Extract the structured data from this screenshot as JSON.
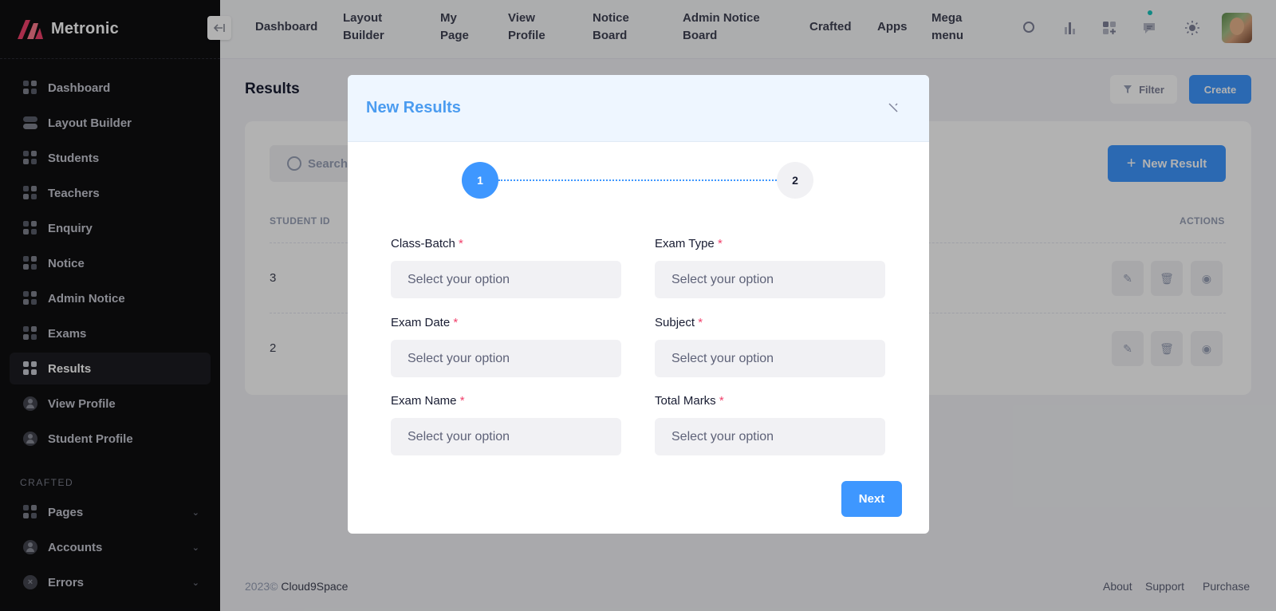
{
  "app": {
    "name": "Metronic"
  },
  "sidebar": {
    "items": [
      {
        "label": "Dashboard",
        "icon": "grid-icon"
      },
      {
        "label": "Layout Builder",
        "icon": "toggle-icon"
      },
      {
        "label": "Students",
        "icon": "grid-icon"
      },
      {
        "label": "Teachers",
        "icon": "grid-icon"
      },
      {
        "label": "Enquiry",
        "icon": "grid-icon"
      },
      {
        "label": "Notice",
        "icon": "grid-icon"
      },
      {
        "label": "Admin Notice",
        "icon": "grid-icon"
      },
      {
        "label": "Exams",
        "icon": "grid-icon"
      },
      {
        "label": "Results",
        "icon": "grid-icon",
        "active": true
      },
      {
        "label": "View Profile",
        "icon": "user-icon"
      },
      {
        "label": "Student Profile",
        "icon": "user-icon"
      }
    ],
    "section_title": "CRAFTED",
    "crafted_items": [
      {
        "label": "Pages",
        "icon": "grid-plus-icon"
      },
      {
        "label": "Accounts",
        "icon": "user-icon"
      },
      {
        "label": "Errors",
        "icon": "error-icon"
      }
    ]
  },
  "header": {
    "nav": [
      {
        "line1": "Dashboard",
        "line2": ""
      },
      {
        "line1": "Layout",
        "line2": "Builder"
      },
      {
        "line1": "My",
        "line2": "Page"
      },
      {
        "line1": "View",
        "line2": "Profile"
      },
      {
        "line1": "Notice",
        "line2": "Board"
      },
      {
        "line1": "Admin Notice",
        "line2": "Board"
      },
      {
        "line1": "Crafted",
        "line2": ""
      },
      {
        "line1": "Apps",
        "line2": ""
      },
      {
        "line1": "Mega",
        "line2": "menu"
      }
    ],
    "icons": [
      "search-icon",
      "chart-icon",
      "apps-icon",
      "chat-icon",
      "sun-icon"
    ]
  },
  "page": {
    "title": "Results",
    "filter_label": "Filter",
    "create_label": "Create",
    "search_placeholder": "Search",
    "new_result_label": "New Result",
    "columns": {
      "student_id": "STUDENT ID",
      "actions": "ACTIONS"
    },
    "rows": [
      {
        "student_id": "3"
      },
      {
        "student_id": "2"
      }
    ]
  },
  "footer": {
    "year": "2023©",
    "company": "Cloud9Space",
    "links": [
      "About",
      "Support",
      "Purchase"
    ]
  },
  "modal": {
    "title": "New Results",
    "steps": [
      "1",
      "2"
    ],
    "fields": [
      {
        "label": "Class-Batch",
        "placeholder": "Select your option"
      },
      {
        "label": "Exam Type",
        "placeholder": "Select your option"
      },
      {
        "label": "Exam Date",
        "placeholder": "Select your option"
      },
      {
        "label": "Subject",
        "placeholder": "Select your option"
      },
      {
        "label": "Exam Name",
        "placeholder": "Select your option"
      },
      {
        "label": "Total Marks",
        "placeholder": "Select your option"
      }
    ],
    "required_mark": "*",
    "next_label": "Next"
  },
  "colors": {
    "primary": "#3e97ff",
    "sidebar": "#0f0f11",
    "required": "#f1416c",
    "modal_header": "#eef6ff"
  }
}
